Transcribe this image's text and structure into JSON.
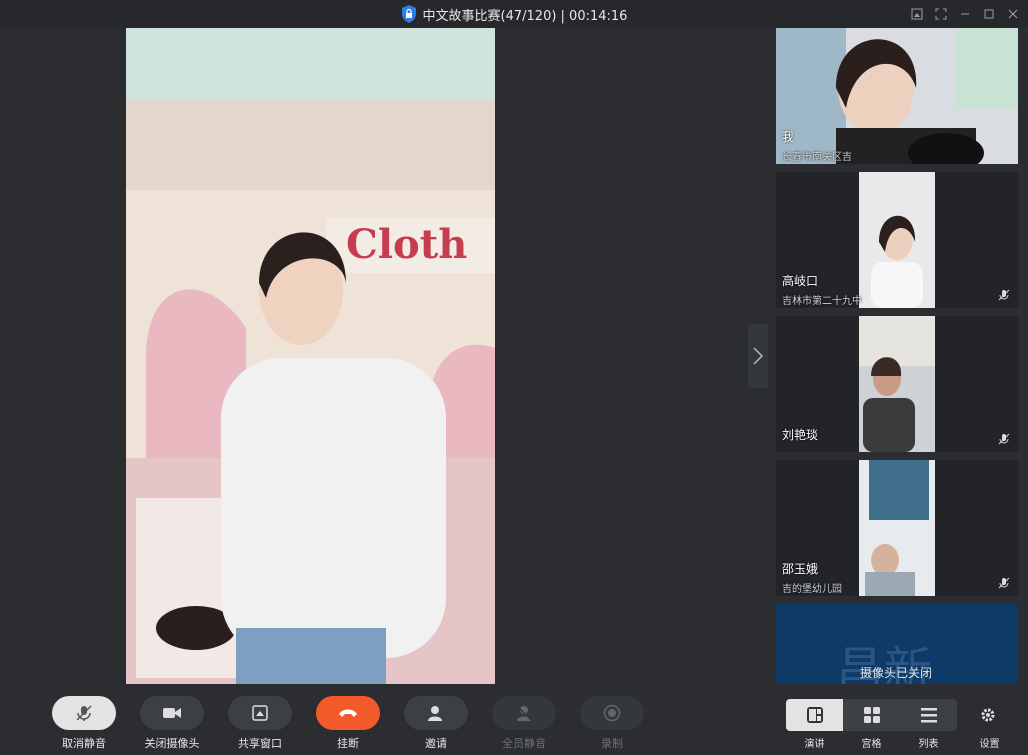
{
  "window": {
    "title": "中文故事比赛(47/120) | 00:14:16",
    "controls": [
      "screenshot-icon",
      "fullscreen-icon",
      "minimize-icon",
      "maximize-icon",
      "close-icon"
    ]
  },
  "main_video": {
    "sign_text": "Cloth"
  },
  "participants": [
    {
      "name": "我",
      "org": "长春市南关区吉",
      "muted": true
    },
    {
      "name": "高岐口",
      "org": "吉林市第二十九中",
      "muted": true
    },
    {
      "name": "刘艳琰",
      "org": "",
      "muted": true
    },
    {
      "name": "邵玉娥",
      "org": "吉的堡幼儿园",
      "muted": true
    },
    {
      "name": "",
      "org": "",
      "status": "摄像头已关闭",
      "bg_text": "昌新"
    }
  ],
  "toolbar": {
    "unmute": "取消静音",
    "camera_off": "关闭摄像头",
    "share": "共享窗口",
    "hangup": "挂断",
    "invite": "邀请",
    "mute_all": "全员静音",
    "record": "录制",
    "layout_speaker": "演讲",
    "layout_gallery": "宫格",
    "layout_list": "列表",
    "settings": "设置"
  },
  "colors": {
    "accent_hangup": "#f25a2a",
    "active_button": "#e3e3e3",
    "lock_blue": "#2f7ee6"
  }
}
